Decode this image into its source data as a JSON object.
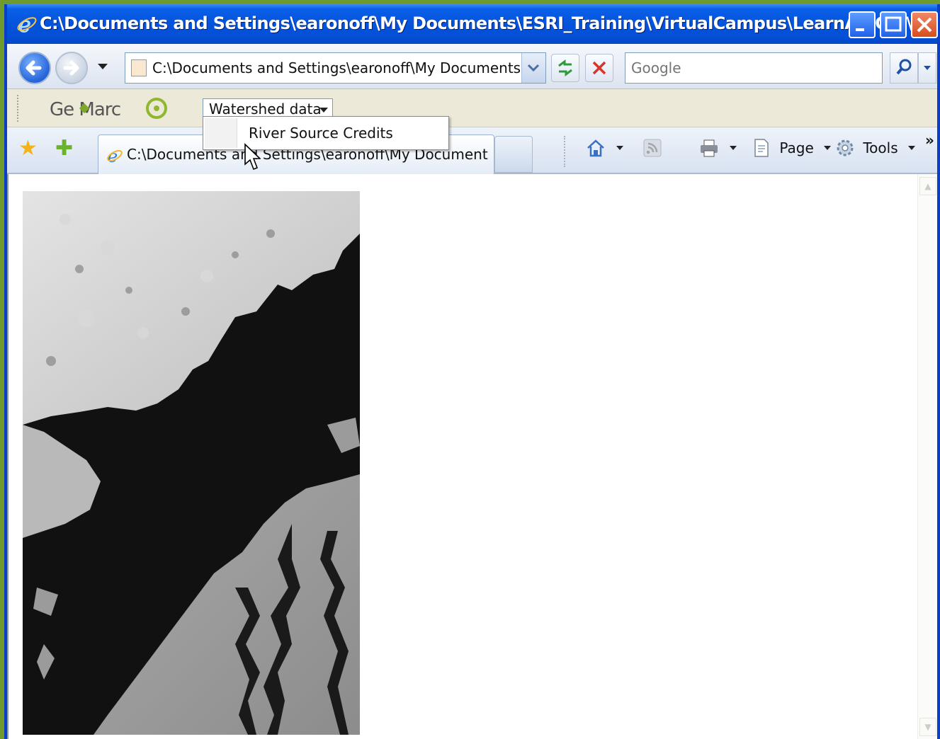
{
  "window": {
    "title": "C:\\Documents and Settings\\earonoff\\My Documents\\ESRI_Training\\VirtualCampus\\LearnArcGIS\\..."
  },
  "nav": {
    "address_value": "C:\\Documents and Settings\\earonoff\\My Documents\\ESR:",
    "search_placeholder": "Google"
  },
  "links_toolbar": {
    "logo_text": "Ge  Marc",
    "select_value": "Watershed data",
    "menu_items": [
      "River Source Credits"
    ]
  },
  "tabs": [
    {
      "label": "C:\\Documents and Settings\\earonoff\\My Documents\\..."
    }
  ],
  "command_bar": {
    "page_label": "Page",
    "tools_label": "Tools"
  },
  "colors": {
    "titlebar": "#0453dc",
    "accent": "#0a3fc4"
  }
}
